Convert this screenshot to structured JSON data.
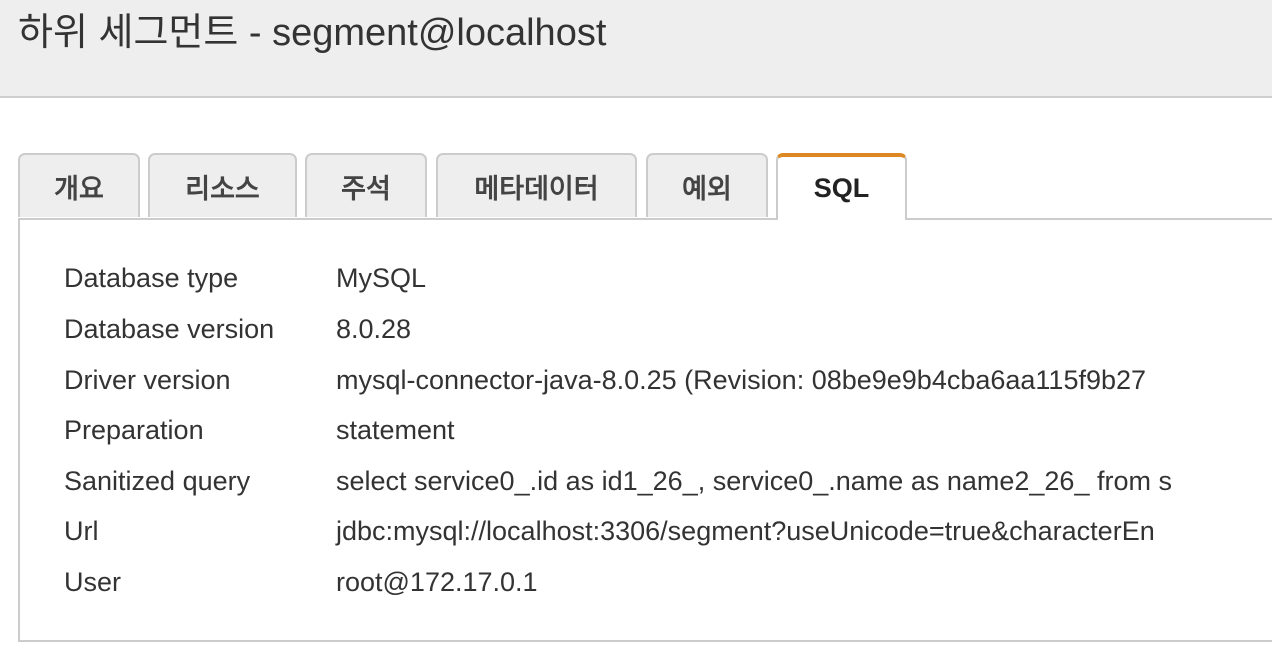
{
  "header": {
    "title": "하위 세그먼트 - segment@localhost"
  },
  "tabs": [
    {
      "label": "개요",
      "active": false
    },
    {
      "label": "리소스",
      "active": false
    },
    {
      "label": "주석",
      "active": false
    },
    {
      "label": "메타데이터",
      "active": false
    },
    {
      "label": "예외",
      "active": false
    },
    {
      "label": "SQL",
      "active": true
    }
  ],
  "sql": {
    "rows": [
      {
        "label": "Database type",
        "value": "MySQL"
      },
      {
        "label": "Database version",
        "value": "8.0.28"
      },
      {
        "label": "Driver version",
        "value": "mysql-connector-java-8.0.25 (Revision: 08be9e9b4cba6aa115f9b27"
      },
      {
        "label": "Preparation",
        "value": "statement"
      },
      {
        "label": "Sanitized query",
        "value": "select service0_.id as id1_26_, service0_.name as name2_26_ from s"
      },
      {
        "label": "Url",
        "value": "jdbc:mysql://localhost:3306/segment?useUnicode=true&characterEn"
      },
      {
        "label": "User",
        "value": "root@172.17.0.1"
      }
    ]
  },
  "colors": {
    "active_tab_accent": "#dd8822",
    "header_background": "#eeeeee",
    "tab_background": "#eeeeee",
    "border": "#cccccc"
  }
}
